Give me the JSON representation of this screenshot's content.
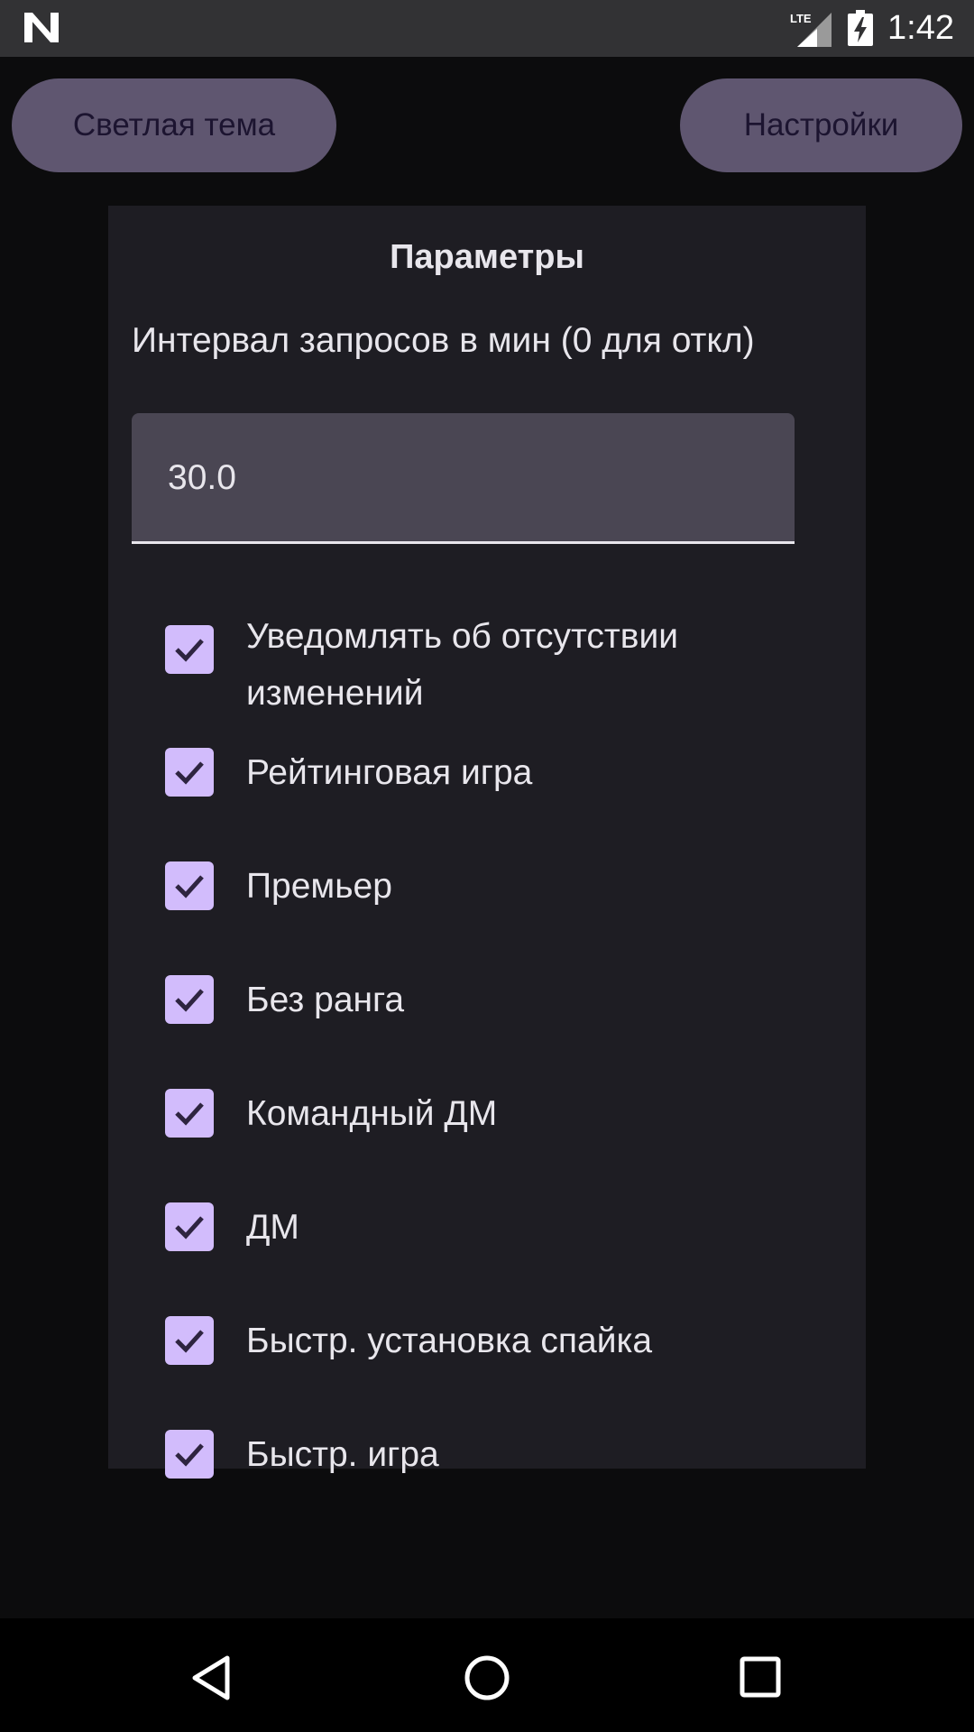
{
  "status_bar": {
    "time": "1:42",
    "network": "LTE",
    "icons": [
      "n-logo-icon",
      "lte-signal-icon",
      "battery-charging-icon"
    ]
  },
  "header": {
    "theme_button_label": "Светлая тема",
    "settings_button_label": "Настройки"
  },
  "card": {
    "title": "Параметры",
    "interval_label": "Интервал запросов в мин (0 для откл)",
    "interval_value": "30.0",
    "options": [
      {
        "label": "Уведомлять об отсутствии изменений",
        "checked": true
      },
      {
        "label": "Рейтинговая игра",
        "checked": true
      },
      {
        "label": "Премьер",
        "checked": true
      },
      {
        "label": "Без ранга",
        "checked": true
      },
      {
        "label": "Командный ДМ",
        "checked": true
      },
      {
        "label": "ДМ",
        "checked": true
      },
      {
        "label": "Быстр. установка спайка",
        "checked": true
      },
      {
        "label": "Быстр. игра",
        "checked": true
      }
    ]
  },
  "colors": {
    "accent": "#d2bcfc",
    "button_bg": "#5f5670",
    "card_bg": "#1e1d23",
    "field_bg": "#4a4653"
  },
  "nav_bar": {
    "icons": [
      "back-icon",
      "home-icon",
      "recents-icon"
    ]
  }
}
